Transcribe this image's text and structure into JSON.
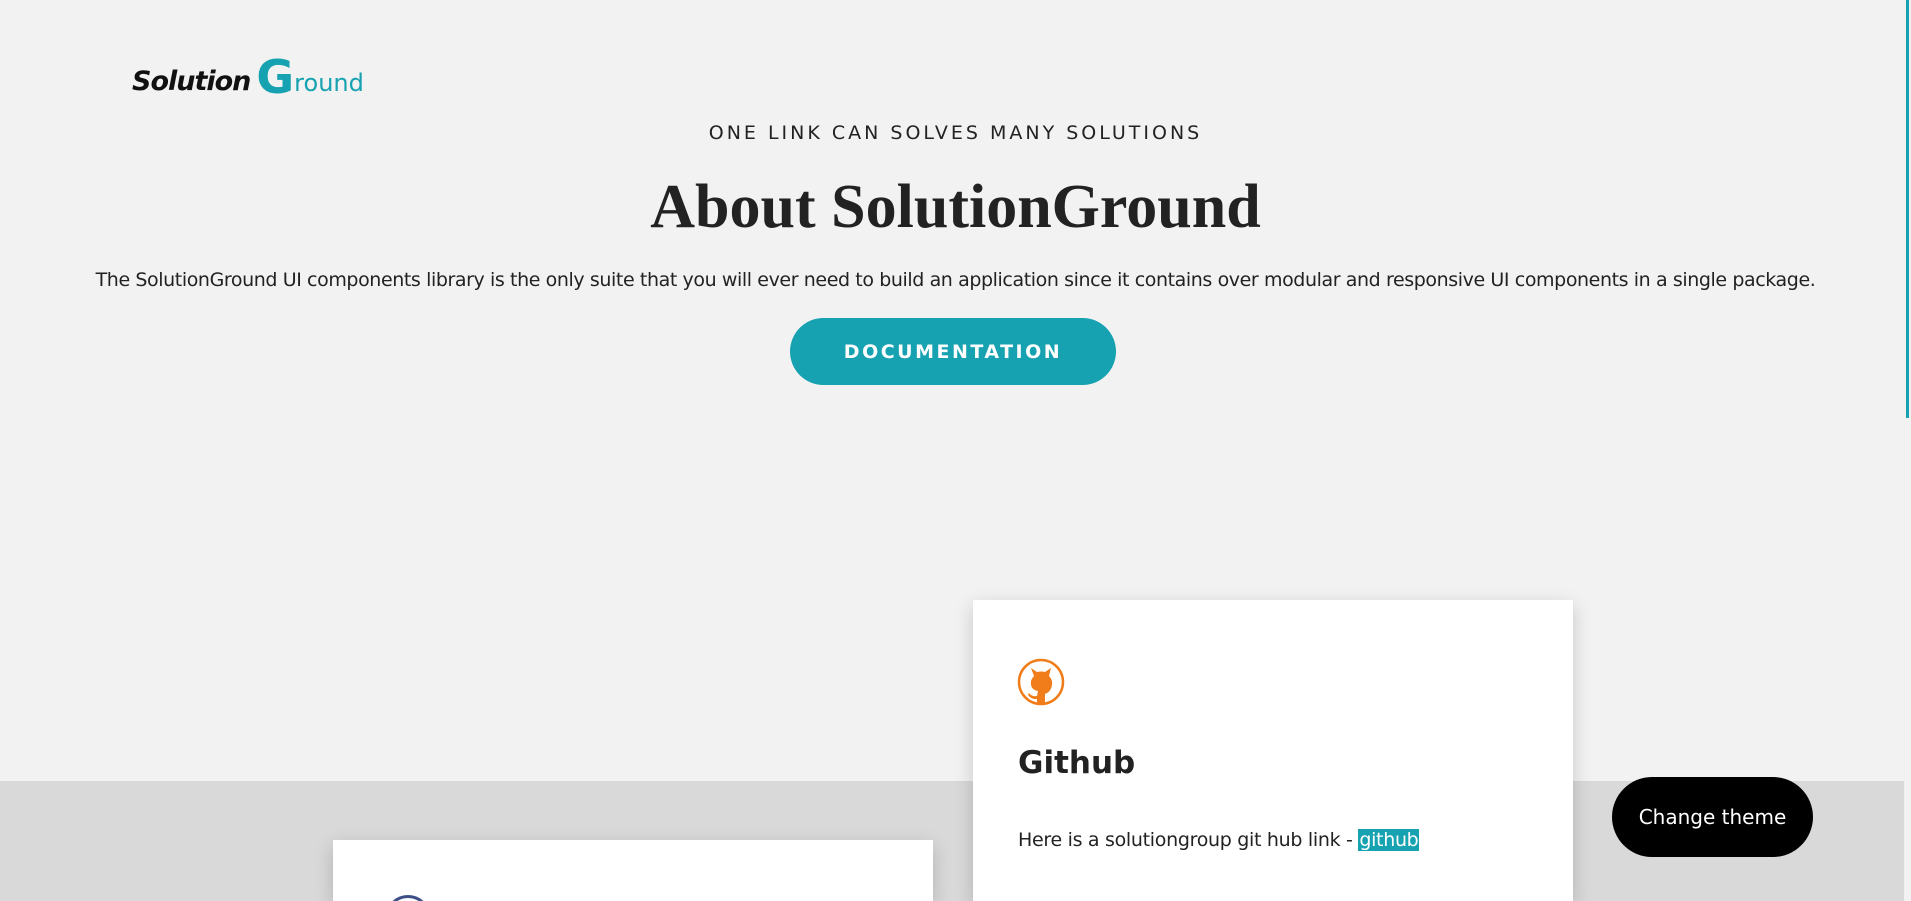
{
  "header": {
    "logo": {
      "part1": "Solution",
      "part2": "G",
      "part3": "round"
    }
  },
  "hero": {
    "tagline": "ONE LINK CAN SOLVES MANY SOLUTIONS",
    "title": "About SolutionGround",
    "description": "The SolutionGround UI components library is the only suite that you will ever need to build an application since it contains over modular and responsive UI components in a single package.",
    "button_label": "DOCUMENTATION"
  },
  "cards": [
    {
      "icon": "github-icon",
      "title": "Github",
      "text": "Here is a solutiongroup git hub link - ",
      "link_label": "github"
    }
  ],
  "theme_button": {
    "label": "Change theme"
  },
  "colors": {
    "accent": "#16a2b0",
    "background": "#f2f2f2",
    "band": "#d9d9d9",
    "github_icon": "#f07d19"
  }
}
